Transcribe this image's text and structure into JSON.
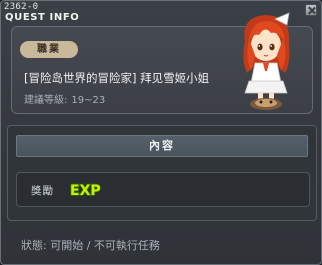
{
  "window": {
    "id": "2362-0",
    "title": "QUEST INFO"
  },
  "info": {
    "job_label": "職業",
    "quest_name": "[冒险岛世界的冒险家] 拜见雪姬小姐",
    "level_label": "建議等級:",
    "level_range": "19~23"
  },
  "content": {
    "header": "內容",
    "reward_label": "獎勵",
    "reward_icon": "exp-icon",
    "reward_text": "EXP"
  },
  "status": {
    "text": "狀態: 可開始 / 不可執行任務"
  },
  "colors": {
    "exp_green": "#c8f000",
    "badge": "#c9b89a",
    "npc_hair": "#d8421c"
  }
}
